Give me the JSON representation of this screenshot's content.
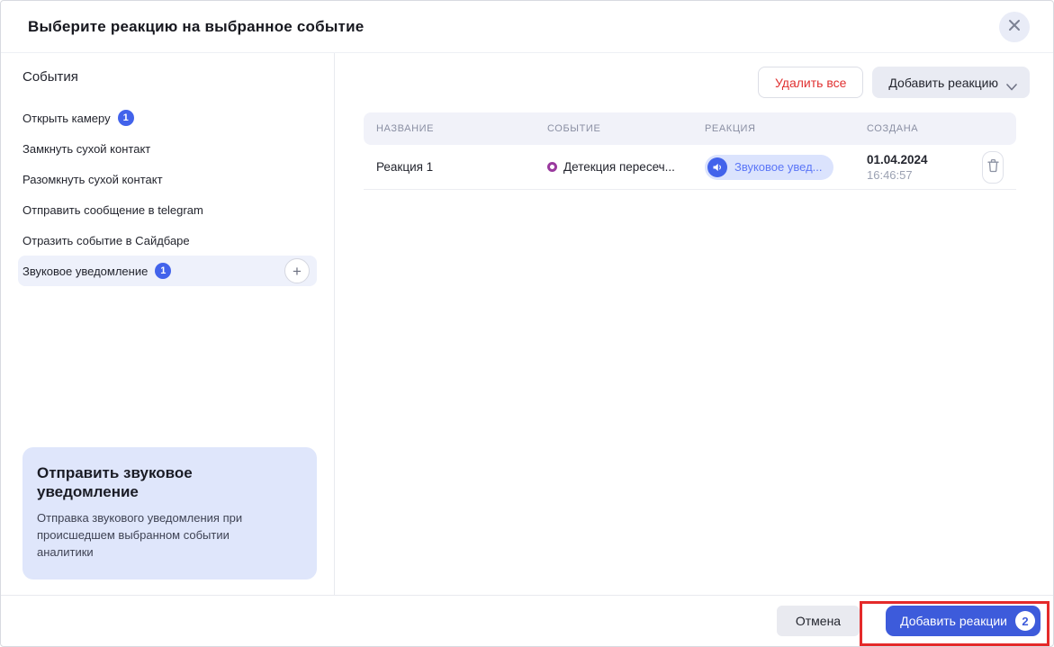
{
  "modal": {
    "title": "Выберите реакцию на выбранное событие"
  },
  "sidebar": {
    "title": "События",
    "items": [
      {
        "label": "Открыть камеру",
        "badge": "1"
      },
      {
        "label": "Замкнуть сухой контакт"
      },
      {
        "label": "Разомкнуть сухой контакт"
      },
      {
        "label": "Отправить сообщение в telegram"
      },
      {
        "label": "Отразить событие в Сайдбаре"
      },
      {
        "label": "Звуковое уведомление",
        "badge": "1",
        "selected": true
      }
    ],
    "info_card": {
      "title": "Отправить звуковое уведомление",
      "description": "Отправка звукового уведомления при происшедшем выбранном событии аналитики"
    }
  },
  "toolbar": {
    "delete_all_label": "Удалить все",
    "add_reaction_label": "Добавить реакцию"
  },
  "table": {
    "headers": [
      "НАЗВАНИЕ",
      "СОБЫТИЕ",
      "РЕАКЦИЯ",
      "СОЗДАНА"
    ],
    "rows": [
      {
        "name": "Реакция 1",
        "event": "Детекция пересеч...",
        "reaction": "Звуковое увед...",
        "created_date": "01.04.2024",
        "created_time": "16:46:57"
      }
    ]
  },
  "footer": {
    "cancel_label": "Отмена",
    "submit_label": "Добавить реакции",
    "submit_badge": "2"
  },
  "colors": {
    "accent_blue": "#4263eb",
    "submit_blue": "#3d5bdb",
    "danger_red": "#e03131",
    "annotation_red": "#e42a2a",
    "event_icon_purple": "#9a3a9e",
    "pill_bg": "#dbe3fd",
    "selected_item_bg": "#eef1fb",
    "info_card_bg": "#dfe6fb",
    "table_header_bg": "#f1f2f9"
  }
}
